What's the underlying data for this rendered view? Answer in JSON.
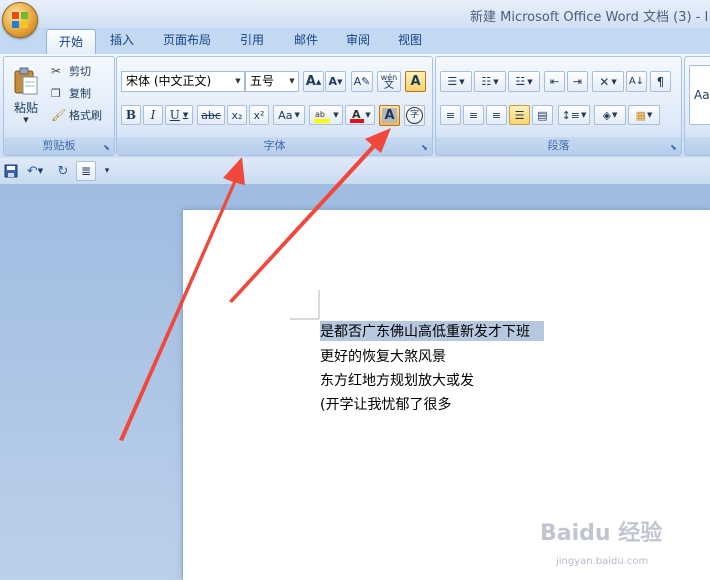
{
  "window": {
    "title": "新建 Microsoft Office Word 文档 (3) - I"
  },
  "tabs": [
    {
      "label": "开始",
      "active": true
    },
    {
      "label": "插入"
    },
    {
      "label": "页面布局"
    },
    {
      "label": "引用"
    },
    {
      "label": "邮件"
    },
    {
      "label": "审阅"
    },
    {
      "label": "视图"
    }
  ],
  "clipboard": {
    "label": "剪贴板",
    "paste": "粘贴",
    "cut": "剪切",
    "copy": "复制",
    "format_painter": "格式刷"
  },
  "font": {
    "label": "字体",
    "font_name": "宋体 (中文正文)",
    "font_size": "五号",
    "bold": "B",
    "italic": "I",
    "underline": "U",
    "strikethrough": "abc",
    "subscript": "x₂",
    "superscript": "x²",
    "change_case": "Aa",
    "grow": "A",
    "shrink": "A",
    "char_shading": "A",
    "phonetic": "wén",
    "enclose": "字",
    "border": "A"
  },
  "paragraph": {
    "label": "段落"
  },
  "styles": {
    "preview": "Aa"
  },
  "document": {
    "lines": [
      "是都否广东佛山高低重新发才下班",
      "更好的恢复大煞风景",
      "东方红地方规划放大或发",
      "(开学让我忧郁了很多"
    ]
  },
  "watermark": {
    "main": "Baidu 经验",
    "sub": "jingyan.baidu.com"
  },
  "colors": {
    "accent_arrow": "#f0483a",
    "highlight": "#b6c8e0",
    "ribbon_active": "#f8d26e"
  }
}
